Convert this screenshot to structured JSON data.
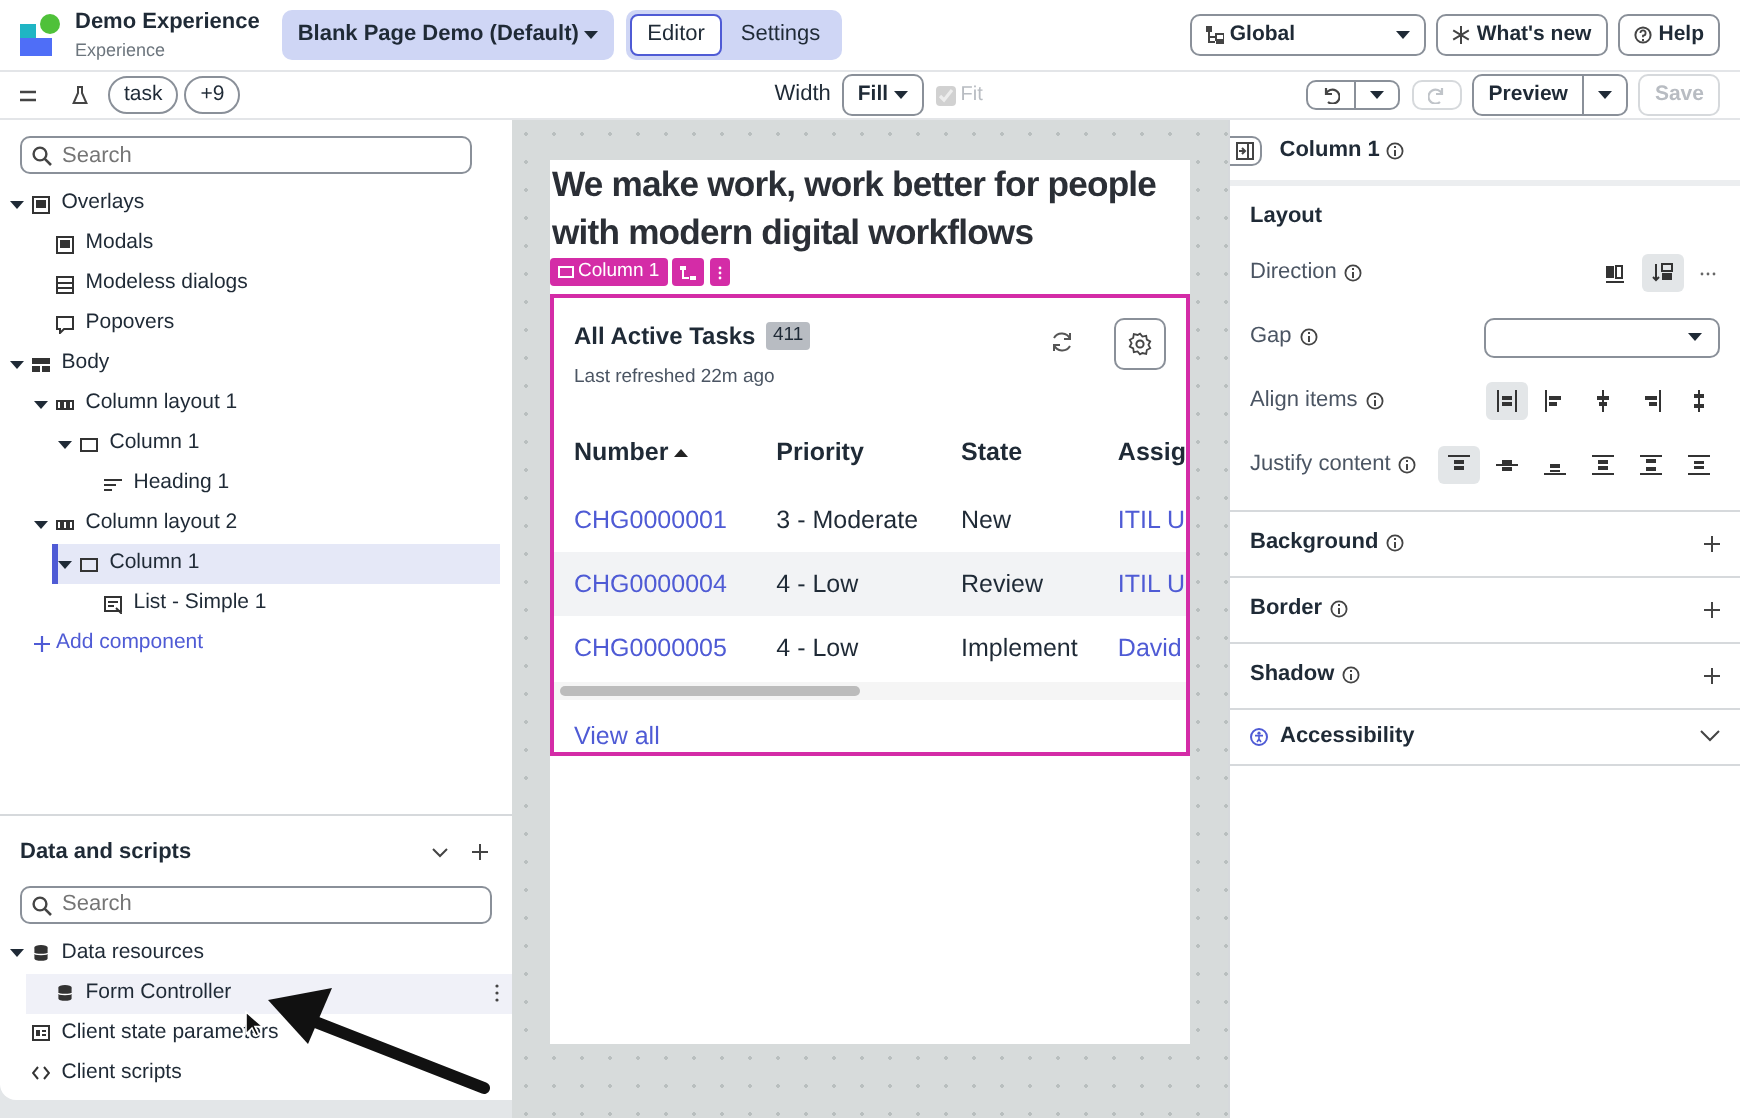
{
  "header": {
    "app_name": "Demo Experience",
    "app_subtitle": "Experience",
    "page_selector": "Blank Page Demo (Default)",
    "mode_tabs": [
      {
        "label": "Editor",
        "selected": true
      },
      {
        "label": "Settings",
        "selected": false
      }
    ],
    "scope_selector": "Global",
    "buttons": [
      {
        "kind": "whatsnew",
        "label": "What's new"
      },
      {
        "kind": "help",
        "label": "Help"
      }
    ]
  },
  "toolbar": {
    "filter_tags": [
      "task",
      "+9"
    ],
    "width_label": "Width",
    "width_value": "Fill",
    "fit": {
      "label": "Fit",
      "checked": true,
      "disabled": true
    },
    "redo_disabled": true,
    "preview": "Preview",
    "save": {
      "label": "Save",
      "disabled": true
    }
  },
  "tree": {
    "search_placeholder": "Search",
    "items": [
      {
        "label": "Overlays",
        "kind": "overlay",
        "expanded": true,
        "selected": false,
        "children": [
          {
            "label": "Modals",
            "kind": "modal",
            "selected": false
          },
          {
            "label": "Modeless dialogs",
            "kind": "modeless",
            "selected": false
          },
          {
            "label": "Popovers",
            "kind": "popover",
            "selected": false
          }
        ]
      },
      {
        "label": "Body",
        "kind": "body",
        "expanded": true,
        "selected": false,
        "children": [
          {
            "label": "Column layout 1",
            "kind": "layout",
            "expanded": true,
            "selected": false,
            "children": [
              {
                "label": "Column 1",
                "kind": "column",
                "expanded": true,
                "selected": false,
                "children": [
                  {
                    "label": "Heading 1",
                    "kind": "heading",
                    "selected": false
                  }
                ]
              }
            ]
          },
          {
            "label": "Column layout 2",
            "kind": "layout",
            "expanded": true,
            "selected": false,
            "children": [
              {
                "label": "Column 1",
                "kind": "column",
                "expanded": true,
                "selected": true,
                "children": [
                  {
                    "label": "List - Simple 1",
                    "kind": "list",
                    "selected": false
                  }
                ]
              }
            ]
          },
          {
            "label": "Add component",
            "kind": "add",
            "selected": false
          }
        ]
      }
    ]
  },
  "data_scripts": {
    "title": "Data and scripts",
    "search_placeholder": "Search",
    "items": [
      {
        "label": "Data resources",
        "kind": "data",
        "expanded": true,
        "selected": false,
        "children": [
          {
            "label": "Form Controller",
            "kind": "data",
            "selected": true
          }
        ]
      },
      {
        "label": "Client state parameters",
        "kind": "state",
        "selected": false
      },
      {
        "label": "Client scripts",
        "kind": "script",
        "selected": false
      }
    ]
  },
  "canvas": {
    "heading": "We make work, work better for people with modern digital workflows",
    "chip": "Column 1",
    "list": {
      "title": "All Active Tasks",
      "count": "411",
      "subtitle": "Last refreshed 22m ago",
      "columns": [
        {
          "label": "Number",
          "sorted": true
        },
        {
          "label": "Priority",
          "sorted": false
        },
        {
          "label": "State",
          "sorted": false
        },
        {
          "label": "Assig",
          "sorted": false
        }
      ],
      "rows": [
        {
          "highlighted": false,
          "cells": [
            "CHG0000001",
            "3 - Moderate",
            "New",
            "ITIL U"
          ]
        },
        {
          "highlighted": true,
          "cells": [
            "CHG0000004",
            "4 - Low",
            "Review",
            "ITIL U"
          ]
        },
        {
          "highlighted": false,
          "cells": [
            "CHG0000005",
            "4 - Low",
            "Implement",
            "David"
          ]
        }
      ],
      "footer_link": "View all"
    }
  },
  "properties": {
    "title": "Column 1",
    "layout": {
      "title": "Layout",
      "rows": [
        {
          "kind": "toggle",
          "label": "Direction",
          "options": [
            {
              "kind": "row",
              "selected": false
            },
            {
              "kind": "column",
              "selected": true
            }
          ]
        },
        {
          "kind": "select",
          "label": "Gap"
        },
        {
          "kind": "toggle",
          "label": "Align items",
          "options": [
            {
              "kind": "stretch",
              "selected": true
            },
            {
              "kind": "start",
              "selected": false
            },
            {
              "kind": "center",
              "selected": false
            },
            {
              "kind": "end",
              "selected": false
            },
            {
              "kind": "baseline",
              "selected": false
            }
          ]
        },
        {
          "kind": "toggle",
          "label": "Justify content",
          "options": [
            {
              "kind": "top",
              "selected": true
            },
            {
              "kind": "middle",
              "selected": false
            },
            {
              "kind": "bottom",
              "selected": false
            },
            {
              "kind": "between",
              "selected": false
            },
            {
              "kind": "around",
              "selected": false
            },
            {
              "kind": "evenly",
              "selected": false
            }
          ]
        }
      ]
    },
    "sections": [
      {
        "label": "Background",
        "kind": "plus"
      },
      {
        "label": "Border",
        "kind": "plus"
      },
      {
        "label": "Shadow",
        "kind": "plus"
      },
      {
        "label": "Accessibility",
        "kind": "chevron"
      }
    ]
  }
}
